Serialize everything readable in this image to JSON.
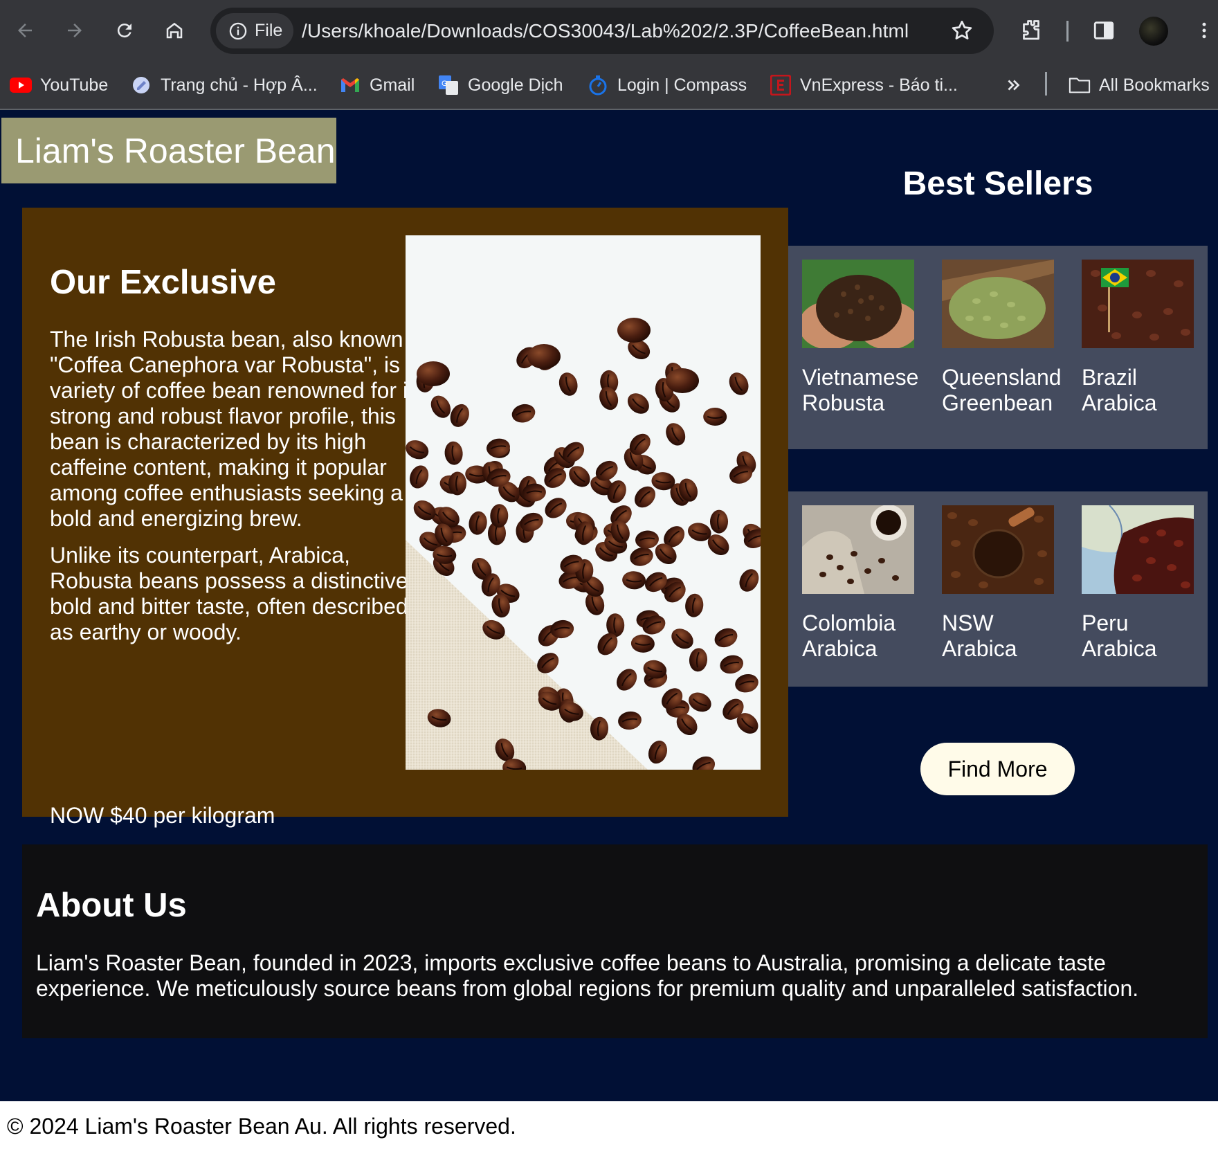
{
  "browser": {
    "site_chip_label": "File",
    "url": "/Users/khoale/Downloads/COS30043/Lab%202/2.3P/CoffeeBean.html",
    "bookmarks": [
      {
        "label": "YouTube",
        "icon": "youtube-icon"
      },
      {
        "label": "Trang chủ - Hợp Â...",
        "icon": "site-icon"
      },
      {
        "label": "Gmail",
        "icon": "gmail-icon"
      },
      {
        "label": "Google Dịch",
        "icon": "google-translate-icon"
      },
      {
        "label": "Login | Compass",
        "icon": "compass-icon"
      },
      {
        "label": "VnExpress - Báo ti...",
        "icon": "vnexpress-icon"
      }
    ],
    "all_bookmarks_label": "All Bookmarks"
  },
  "site": {
    "title": "Liam's Roaster Bean"
  },
  "exclusive": {
    "heading": "Our Exclusive",
    "paragraph1": "The Irish Robusta bean, also known as \"Coffea Canephora var Robusta\", is a variety of coffee bean renowned for its strong and robust flavor profile, this bean is characterized by its high caffeine content, making it popular among coffee enthusiasts seeking a bold and energizing brew.",
    "paragraph2": "Unlike its counterpart, Arabica, Robusta beans possess a distinctively bold and bitter taste, often described as earthy or woody.",
    "price": "NOW $40 per kilogram"
  },
  "best_sellers": {
    "heading": "Best Sellers",
    "items": [
      {
        "name_line1": "Vietnamese",
        "name_line2": "Robusta"
      },
      {
        "name_line1": "Queensland",
        "name_line2": "Greenbean"
      },
      {
        "name_line1": "Brazil",
        "name_line2": "Arabica"
      },
      {
        "name_line1": "Colombia",
        "name_line2": "Arabica"
      },
      {
        "name_line1": "NSW",
        "name_line2": "Arabica"
      },
      {
        "name_line1": "Peru",
        "name_line2": "Arabica"
      }
    ],
    "find_more_label": "Find More"
  },
  "about": {
    "heading": "About Us",
    "text": "Liam's Roaster Bean, founded in 2023, imports exclusive coffee beans to Australia, promising a delicate taste experience. We meticulously source beans from global regions for premium quality and unparalleled satisfaction."
  },
  "footer": {
    "text": "© 2024 Liam's Roaster Bean Au. All rights reserved."
  },
  "colors": {
    "page_background": "#011035",
    "title_background": "#9a9a72",
    "exclusive_background": "#513204",
    "best_sellers_background": "#444b5e",
    "about_background": "#0f0f11",
    "button_background": "#fffbe9"
  }
}
